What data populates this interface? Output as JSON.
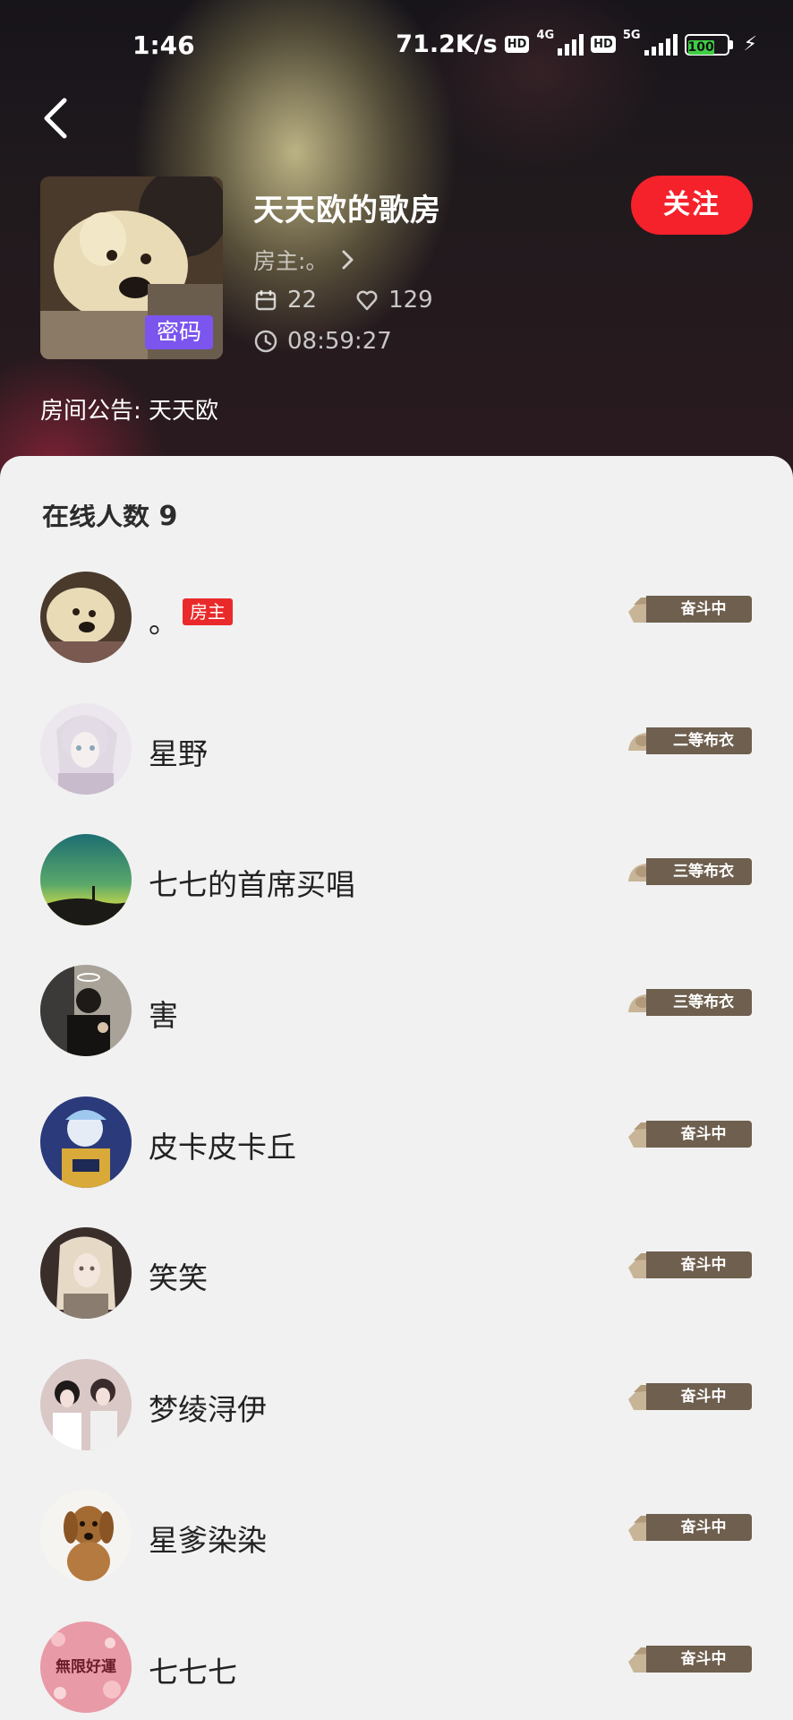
{
  "status_bar": {
    "time": "1:46",
    "speed": "71.2K/s",
    "hd1": "HD",
    "net1": "4G",
    "hd2": "HD",
    "net2": "5G",
    "battery": "100"
  },
  "room": {
    "title": "天天欧的歌房",
    "host_label": "房主:。",
    "password_badge": "密码",
    "seats": "22",
    "popularity": "129",
    "duration": "08:59:27",
    "follow_label": "关注",
    "notice": "房间公告: 天天欧"
  },
  "online": {
    "title": "在线人数 9",
    "members": [
      {
        "name": "。",
        "tag": "房主",
        "rank": "奋斗中",
        "rank_style": "book"
      },
      {
        "name": "星野",
        "rank": "二等布衣",
        "rank_style": "hat"
      },
      {
        "name": "七七的首席买唱",
        "rank": "三等布衣",
        "rank_style": "hat"
      },
      {
        "name": "害",
        "rank": "三等布衣",
        "rank_style": "hat"
      },
      {
        "name": "皮卡皮卡丘",
        "rank": "奋斗中",
        "rank_style": "book"
      },
      {
        "name": "笑笑",
        "rank": "奋斗中",
        "rank_style": "book"
      },
      {
        "name": "梦绫浔伊",
        "rank": "奋斗中",
        "rank_style": "book"
      },
      {
        "name": "星爹染染",
        "rank": "奋斗中",
        "rank_style": "book"
      },
      {
        "name": "七七七",
        "rank": "奋斗中",
        "rank_style": "book",
        "avatar_text": "無限好運"
      }
    ]
  },
  "colors": {
    "accent_red": "#f5212b",
    "host_tag_red": "#ea2a2a",
    "password_purple": "#7b55ee",
    "rank_brown": "#6e5f4e",
    "rank_tan": "#c8b497"
  },
  "icons": {
    "back": "chevron-left-icon",
    "host_arrow": "chevron-right-icon",
    "seats": "calendar-icon",
    "popularity": "heart-icon",
    "duration": "clock-icon"
  }
}
